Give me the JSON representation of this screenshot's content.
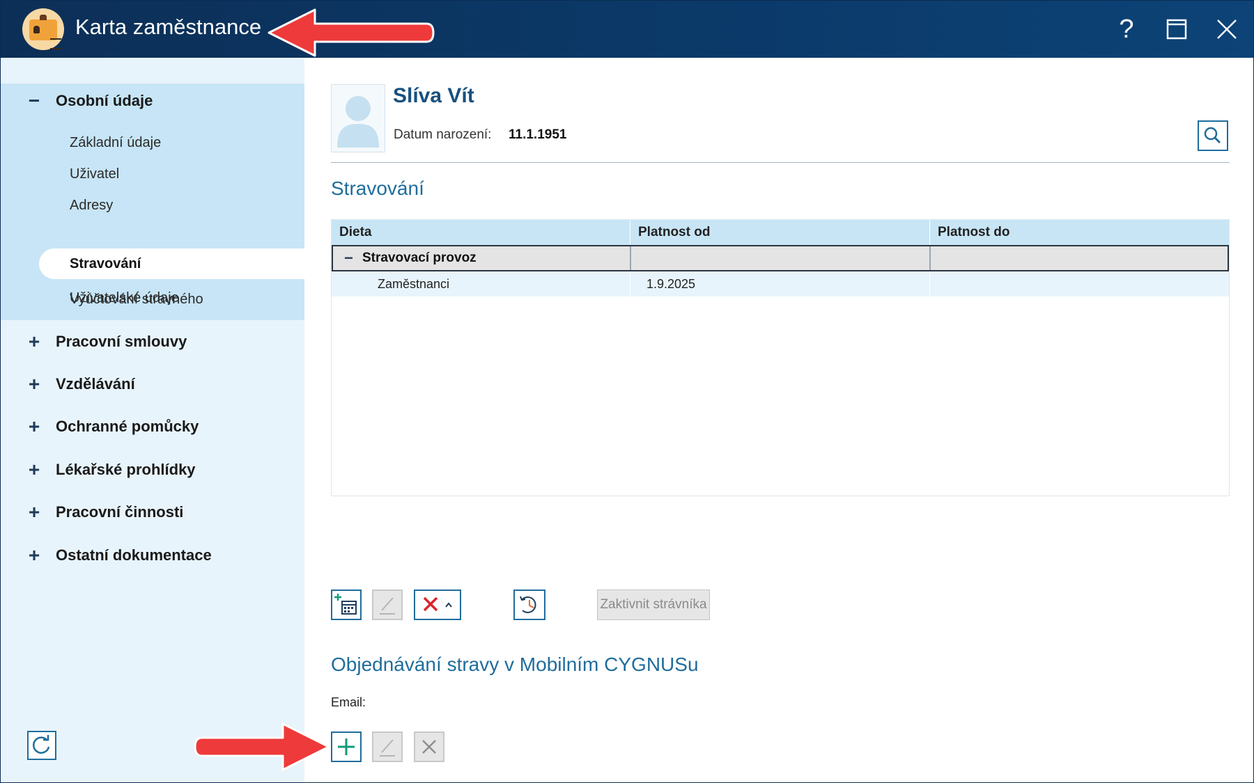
{
  "window": {
    "title": "Karta zaměstnance",
    "help_label": "?"
  },
  "sidebar": {
    "expanded_group": {
      "sign": "−",
      "label": "Osobní údaje"
    },
    "items": [
      "Základní údaje",
      "Uživatel",
      "Adresy",
      "Stravování",
      "Vyúčtování stravného",
      "Uživatelské údaje"
    ],
    "selected_item": "Stravování",
    "collapsed_groups": [
      {
        "sign": "+",
        "label": "Pracovní smlouvy"
      },
      {
        "sign": "+",
        "label": "Vzdělávání"
      },
      {
        "sign": "+",
        "label": "Ochranné pomůcky"
      },
      {
        "sign": "+",
        "label": "Lékařské prohlídky"
      },
      {
        "sign": "+",
        "label": "Pracovní činnosti"
      },
      {
        "sign": "+",
        "label": "Ostatní dokumentace"
      }
    ]
  },
  "person": {
    "name": "Slíva Vít",
    "dob_label": "Datum narození:",
    "dob_value": "11.1.1951"
  },
  "stravovani": {
    "title": "Stravování",
    "columns": [
      "Dieta",
      "Platnost od",
      "Platnost do"
    ],
    "group": {
      "toggle": "−",
      "label": "Stravovací provoz"
    },
    "rows": [
      {
        "dieta": "Zaměstnanci",
        "platnost_od": "1.9.2025",
        "platnost_do": ""
      }
    ],
    "activate_button": "Zaktivnit strávníka"
  },
  "mobile": {
    "title": "Objednávání stravy v Mobilním CYGNUSu",
    "email_label": "Email:"
  },
  "icons": {
    "app": "employee-card-icon",
    "help": "help-icon",
    "maximize": "maximize-icon",
    "close": "close-icon",
    "search": "search-icon",
    "refresh": "refresh-icon",
    "add_calendar": "add-calendar-icon",
    "edit": "edit-icon",
    "delete": "delete-icon",
    "history": "history-icon",
    "add": "add-icon"
  },
  "colors": {
    "title_bar": "#0b3a6a",
    "accent": "#1f6d9c",
    "sidebar_bg": "#e8f4fb",
    "sidebar_expanded_bg": "#c7e5f6",
    "delete_red": "#d9262c",
    "add_green": "#0f9b7a",
    "annotation_arrow": "#ee3a3a"
  }
}
